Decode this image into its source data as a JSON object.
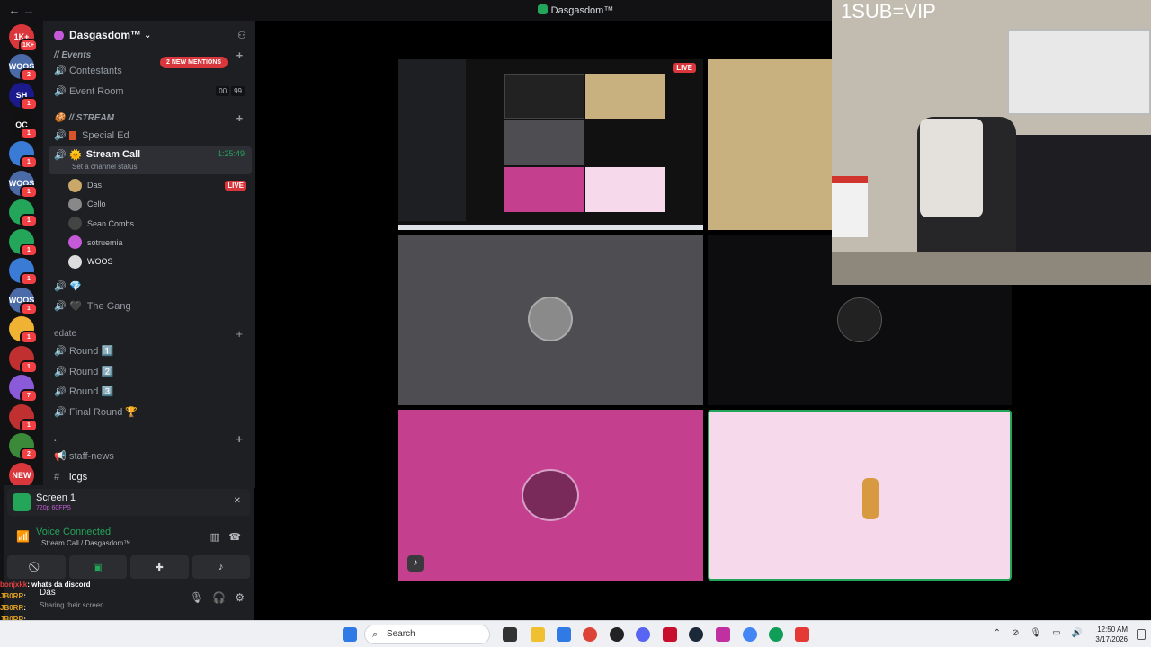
{
  "window": {
    "title": "Dasgasdom™",
    "back_glyph": "←",
    "forward_glyph": "→"
  },
  "servers": [
    {
      "label": "1K+",
      "badge": "1K+",
      "color": "#da373c"
    },
    {
      "label": "WOOS",
      "badge": "2",
      "color": "#4a6aa8"
    },
    {
      "label": "SH",
      "badge": "1",
      "color": "#1a1a8c"
    },
    {
      "label": "OC",
      "badge": "1",
      "color": "#111111"
    },
    {
      "label": "",
      "badge": "1",
      "color": "#3a7bd5"
    },
    {
      "label": "WOOS",
      "badge": "1",
      "color": "#4a6aa8"
    },
    {
      "label": "",
      "badge": "1",
      "color": "#23a55a"
    },
    {
      "label": "",
      "badge": "1",
      "color": "#23a55a"
    },
    {
      "label": "",
      "badge": "1",
      "color": "#3a7bd5"
    },
    {
      "label": "WOOS",
      "badge": "1",
      "color": "#4a6aa8"
    },
    {
      "label": "",
      "badge": "1",
      "color": "#f0b232"
    },
    {
      "label": "",
      "badge": "1",
      "color": "#c03030"
    },
    {
      "label": "",
      "badge": "7",
      "color": "#8a5ad8"
    },
    {
      "label": "",
      "badge": "1",
      "color": "#c03030"
    },
    {
      "label": "",
      "badge": "2",
      "color": "#3a8a3a"
    },
    {
      "label": "NEW",
      "badge": "",
      "color": "#da373c"
    }
  ],
  "server": {
    "name": "Dasgasdom™",
    "chevron": "⌄",
    "invite_glyph": "⚇"
  },
  "mentions": "2 NEW MENTIONS",
  "channels": {
    "events_cat": "// Events",
    "contestants": "Contestants",
    "event_room": "Event Room",
    "event_room_counts": [
      "00",
      "99"
    ],
    "stream_cat": "// STREAM",
    "special_ed": "Special Ed",
    "stream_call": "Stream Call",
    "stream_call_timer": "1:25:49",
    "set_status": "Set a channel status",
    "users": [
      {
        "name": "Das",
        "live": "LIVE",
        "color": "#c9a86a"
      },
      {
        "name": "Cello",
        "live": "",
        "color": "#888888"
      },
      {
        "name": "Sean Combs",
        "live": "",
        "color": "#444444"
      },
      {
        "name": "sotruemia",
        "live": "",
        "color": "#c45ad8"
      },
      {
        "name": "WOOS",
        "live": "",
        "color": "#dddddd"
      }
    ],
    "the_gang": "The Gang",
    "edate_cat": "edate",
    "rounds": [
      "Round 1️⃣",
      "Round 2️⃣",
      "Round 3️⃣",
      "Final Round 🏆"
    ],
    "dot_cat": ".",
    "staff_news": "staff-news",
    "logs": "logs"
  },
  "panel": {
    "screen_title": "Screen 1",
    "screen_quality": "720p 60FPS",
    "voice_connected": "Voice Connected",
    "voice_location": "Stream Call / Dasgasdom™",
    "user_name": "Das",
    "user_status": "Sharing their screen"
  },
  "chat": [
    {
      "user": "bonjxkk",
      "text": ": whats da discord",
      "color": "#e04040"
    },
    {
      "user": "JB0RR",
      "text": ":",
      "color": "#e0a020"
    },
    {
      "user": "JB0RR",
      "text": ":",
      "color": "#e0a020"
    },
    {
      "user": "JB0RR",
      "text": ":",
      "color": "#e0a020"
    },
    {
      "user": "JB0RR",
      "text": ":",
      "color": "#e0a020"
    }
  ],
  "tiles": {
    "tan_color": "#c9b07f",
    "gray_color": "#4e4d52",
    "black_color": "#0d0d0f",
    "pink_color": "#c4408f",
    "light_pink_color": "#f7d9ec",
    "live_badge": "LIVE"
  },
  "cam": {
    "overlay": "1SUB=VIP"
  },
  "taskbar": {
    "search": "Search",
    "time": "12:50 AM",
    "date": "3/17/2026"
  }
}
